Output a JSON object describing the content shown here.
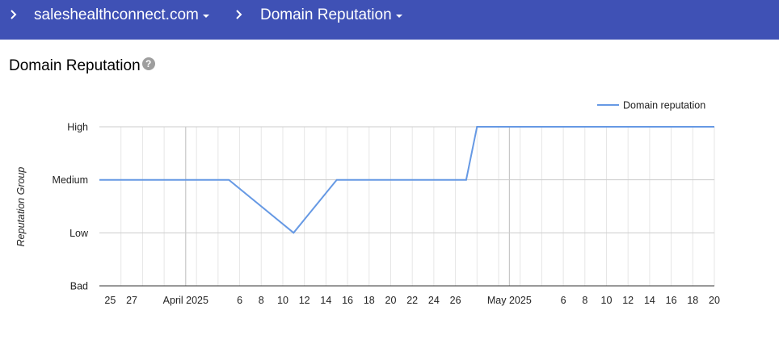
{
  "breadcrumb": {
    "domain": "saleshealthconnect.com",
    "page": "Domain Reputation"
  },
  "card": {
    "title": "Domain Reputation",
    "help_icon": "?"
  },
  "chart_data": {
    "type": "line",
    "title": "",
    "xlabel": "",
    "ylabel": "Reputation Group",
    "y_categories": [
      "Bad",
      "Low",
      "Medium",
      "High"
    ],
    "x_tick_labels": [
      "25",
      "27",
      "April 2025",
      "6",
      "8",
      "10",
      "12",
      "14",
      "16",
      "18",
      "20",
      "22",
      "24",
      "26",
      "May 2025",
      "6",
      "8",
      "10",
      "12",
      "14",
      "16",
      "18",
      "20"
    ],
    "series": [
      {
        "name": "Domain reputation",
        "color": "#6699e4",
        "x": [
          "2025-03-24",
          "2025-04-05",
          "2025-04-11",
          "2025-04-15",
          "2025-04-27",
          "2025-04-28",
          "2025-05-20"
        ],
        "y": [
          "Medium",
          "Medium",
          "Low",
          "Medium",
          "Medium",
          "High",
          "High"
        ]
      }
    ],
    "legend_position": "top-right",
    "grid": true
  }
}
